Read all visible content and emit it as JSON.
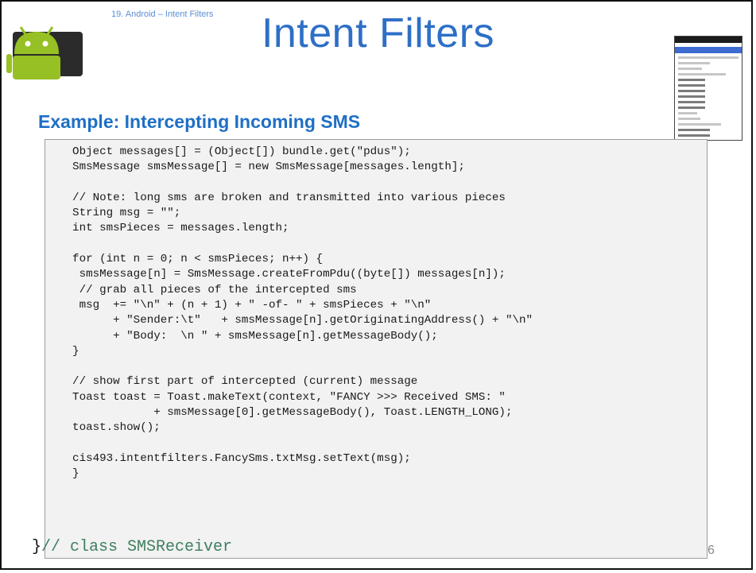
{
  "slide": {
    "header_caption": "19. Android – Intent Filters",
    "title": "Intent Filters",
    "subtitle": "Example: Intercepting Incoming SMS",
    "page_number": "6"
  },
  "code_lines": [
    "    Object messages[] = (Object[]) bundle.get(\"pdus\");",
    "    SmsMessage smsMessage[] = new SmsMessage[messages.length];",
    "",
    "    // Note: long sms are broken and transmitted into various pieces",
    "    String msg = \"\";",
    "    int smsPieces = messages.length;",
    "",
    "    for (int n = 0; n < smsPieces; n++) {",
    "     smsMessage[n] = SmsMessage.createFromPdu((byte[]) messages[n]);",
    "     // grab all pieces of the intercepted sms",
    "     msg  += \"\\n\" + (n + 1) + \" -of- \" + smsPieces + \"\\n\"",
    "          + \"Sender:\\t\"   + smsMessage[n].getOriginatingAddress() + \"\\n\"",
    "          + \"Body:  \\n \" + smsMessage[n].getMessageBody();",
    "    }",
    "",
    "    // show first part of intercepted (current) message",
    "    Toast toast = Toast.makeText(context, \"FANCY >>> Received SMS: \"",
    "                + smsMessage[0].getMessageBody(), Toast.LENGTH_LONG);",
    "    toast.show();",
    "",
    "    cis493.intentfilters.FancySms.txtMsg.setText(msg);",
    "    }"
  ],
  "closing": {
    "brace": "}",
    "comment": "// class SMSReceiver"
  },
  "colors": {
    "title": "#2e6fc7",
    "subtitle": "#1f6fc5",
    "keyword": "#7f0055",
    "string": "#2a00ff",
    "comment": "#3f7f5f",
    "code_background": "#f2f2f2"
  },
  "icons": {
    "logo": "android-logo",
    "thumbnail": "phone-screenshot"
  }
}
